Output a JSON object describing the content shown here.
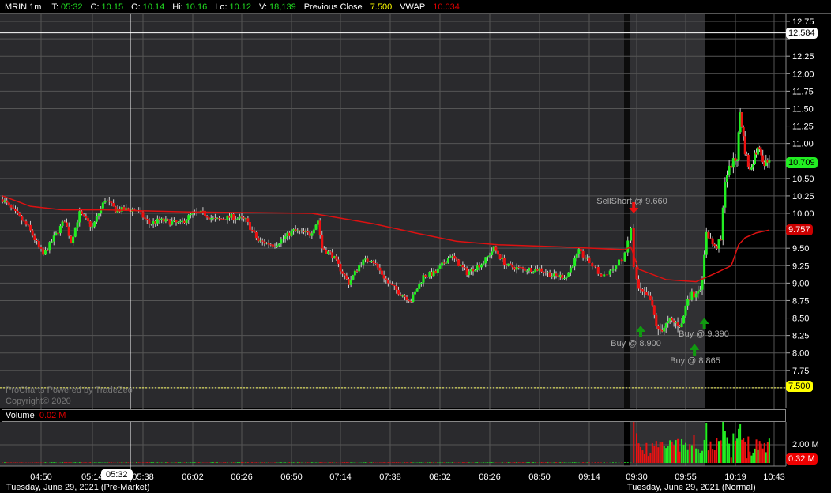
{
  "header": {
    "symbol": "MRIN 1m",
    "t_label": "T:",
    "t": "05:32",
    "c_label": "C:",
    "c": "10.15",
    "o_label": "O:",
    "o": "10.14",
    "hi_label": "Hi:",
    "hi": "10.16",
    "lo_label": "Lo:",
    "lo": "10.12",
    "v_label": "V:",
    "v": "18,139",
    "prev_label": "Previous Close",
    "prev": "7.500",
    "vwap_label": "VWAP",
    "vwap": "10.034"
  },
  "watermark": {
    "line1": "ProCharts Powered by TradeZeo",
    "line2": "Copyright© 2020"
  },
  "volume": {
    "label": "Volume",
    "value": "0.02 M",
    "axis_label": "2.00 M",
    "current": "0.32 M"
  },
  "price_labels": {
    "crosshair": "12.584",
    "last": "10.709",
    "vwap": "9.757",
    "prev_close": "7.500"
  },
  "crosshair_time": "05:32",
  "dates": {
    "pre": "Tuesday, June 29, 2021 (Pre-Market)",
    "normal": "Tuesday, June 29, 2021 (Normal)"
  },
  "colors": {
    "up": "#22ee22",
    "down": "#ee1111",
    "vwap": "#dd1111",
    "prev_close": "#ffff66"
  },
  "chart_data": {
    "type": "candlestick",
    "y_ticks": [
      "12.75",
      "12.50",
      "12.25",
      "12.00",
      "11.75",
      "11.50",
      "11.25",
      "11.00",
      "10.75",
      "10.50",
      "10.25",
      "10.00",
      "9.75",
      "9.50",
      "9.25",
      "9.00",
      "8.75",
      "8.50",
      "8.25",
      "8.00",
      "7.75",
      "7.50"
    ],
    "ylim": [
      7.5,
      12.75
    ],
    "x_ticks": [
      "04:50",
      "05:14",
      "05:38",
      "06:02",
      "06:26",
      "06:50",
      "07:14",
      "07:38",
      "08:02",
      "08:26",
      "08:50",
      "09:14",
      "09:30",
      "09:55",
      "10:19",
      "10:43"
    ],
    "price_path": [
      [
        "04:32",
        10.2
      ],
      [
        "04:38",
        10.0
      ],
      [
        "04:44",
        9.8
      ],
      [
        "04:51",
        9.4
      ],
      [
        "04:57",
        9.7
      ],
      [
        "05:01",
        9.9
      ],
      [
        "05:04",
        9.6
      ],
      [
        "05:08",
        10.0
      ],
      [
        "05:14",
        9.8
      ],
      [
        "05:20",
        10.2
      ],
      [
        "05:25",
        10.05
      ],
      [
        "05:35",
        10.05
      ],
      [
        "05:41",
        9.85
      ],
      [
        "05:46",
        9.9
      ],
      [
        "05:56",
        9.85
      ],
      [
        "06:02",
        10.0
      ],
      [
        "06:07",
        10.0
      ],
      [
        "06:13",
        9.9
      ],
      [
        "06:21",
        9.95
      ],
      [
        "06:28",
        9.9
      ],
      [
        "06:34",
        9.6
      ],
      [
        "06:42",
        9.55
      ],
      [
        "06:51",
        9.75
      ],
      [
        "06:59",
        9.7
      ],
      [
        "07:03",
        9.9
      ],
      [
        "07:05",
        9.5
      ],
      [
        "07:10",
        9.4
      ],
      [
        "07:18",
        9.0
      ],
      [
        "07:24",
        9.3
      ],
      [
        "07:29",
        9.35
      ],
      [
        "07:37",
        9.0
      ],
      [
        "07:43",
        8.85
      ],
      [
        "07:48",
        8.75
      ],
      [
        "07:54",
        9.1
      ],
      [
        "08:00",
        9.15
      ],
      [
        "08:07",
        9.4
      ],
      [
        "08:15",
        9.15
      ],
      [
        "08:23",
        9.3
      ],
      [
        "08:28",
        9.5
      ],
      [
        "08:34",
        9.25
      ],
      [
        "08:42",
        9.2
      ],
      [
        "08:50",
        9.2
      ],
      [
        "08:57",
        9.1
      ],
      [
        "09:03",
        9.1
      ],
      [
        "09:09",
        9.45
      ],
      [
        "09:14",
        9.3
      ],
      [
        "09:18",
        9.1
      ],
      [
        "09:22",
        9.2
      ],
      [
        "09:26",
        9.4
      ],
      [
        "09:28",
        9.8
      ],
      [
        "09:29",
        9.2
      ],
      [
        "09:31",
        8.9
      ],
      [
        "09:37",
        8.75
      ],
      [
        "09:41",
        8.3
      ],
      [
        "09:47",
        8.45
      ],
      [
        "09:53",
        8.4
      ],
      [
        "09:56",
        8.8
      ],
      [
        "09:59",
        8.85
      ],
      [
        "10:03",
        9.0
      ],
      [
        "10:05",
        9.75
      ],
      [
        "10:09",
        9.5
      ],
      [
        "10:12",
        9.6
      ],
      [
        "10:14",
        10.5
      ],
      [
        "10:17",
        10.7
      ],
      [
        "10:20",
        10.8
      ],
      [
        "10:22",
        11.45
      ],
      [
        "10:25",
        10.9
      ],
      [
        "10:28",
        10.6
      ],
      [
        "10:31",
        10.85
      ],
      [
        "10:34",
        10.95
      ],
      [
        "10:37",
        10.7
      ],
      [
        "10:40",
        10.8
      ]
    ],
    "vwap_path": [
      [
        "04:32",
        10.25
      ],
      [
        "04:45",
        10.1
      ],
      [
        "05:00",
        10.05
      ],
      [
        "05:20",
        10.05
      ],
      [
        "06:00",
        10.02
      ],
      [
        "07:00",
        10.0
      ],
      [
        "07:10",
        9.95
      ],
      [
        "07:30",
        9.85
      ],
      [
        "07:50",
        9.72
      ],
      [
        "08:10",
        9.6
      ],
      [
        "08:30",
        9.55
      ],
      [
        "09:00",
        9.52
      ],
      [
        "09:26",
        9.48
      ],
      [
        "09:28",
        9.52
      ],
      [
        "09:31",
        9.2
      ],
      [
        "09:45",
        9.05
      ],
      [
        "10:00",
        9.02
      ],
      [
        "10:10",
        9.15
      ],
      [
        "10:17",
        9.25
      ],
      [
        "10:21",
        9.55
      ],
      [
        "10:25",
        9.65
      ],
      [
        "10:32",
        9.72
      ],
      [
        "10:40",
        9.76
      ]
    ],
    "trades": [
      {
        "label": "SellShort @ 9.660",
        "side": "sell",
        "time": "09:29",
        "price": 9.66
      },
      {
        "label": "Buy @ 8.900",
        "side": "buy",
        "time": "09:30",
        "price": 8.9
      },
      {
        "label": "Buy @ 9.390",
        "side": "buy",
        "time": "10:04",
        "price": 9.39
      },
      {
        "label": "Buy @ 8.865",
        "side": "buy",
        "time": "10:00",
        "price": 8.865
      }
    ]
  }
}
